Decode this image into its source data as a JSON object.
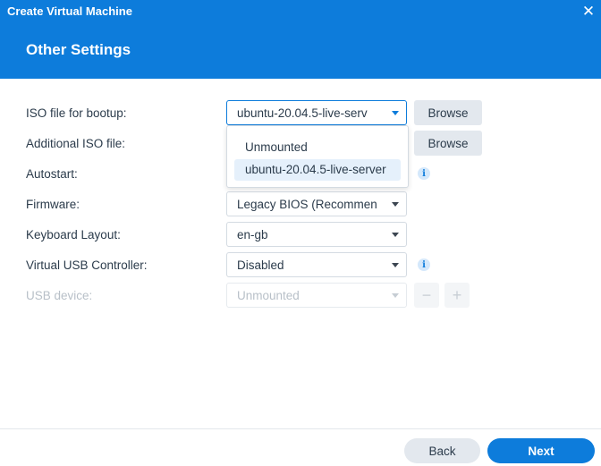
{
  "window": {
    "title": "Create Virtual Machine",
    "close_icon": "close-icon",
    "page_title": "Other Settings",
    "accent_color": "#0d7cdb"
  },
  "form": {
    "iso_bootup": {
      "label": "ISO file for bootup:",
      "value": "ubuntu-20.04.5-live-serv",
      "browse": "Browse"
    },
    "additional_iso": {
      "label": "Additional ISO file:",
      "browse": "Browse"
    },
    "autostart": {
      "label": "Autostart:",
      "info_icon": "info-icon"
    },
    "firmware": {
      "label": "Firmware:",
      "value": "Legacy BIOS (Recommen"
    },
    "keyboard": {
      "label": "Keyboard Layout:",
      "value": "en-gb"
    },
    "usb_controller": {
      "label": "Virtual USB Controller:",
      "value": "Disabled",
      "info_icon": "info-icon"
    },
    "usb_device": {
      "label": "USB device:",
      "value": "Unmounted",
      "disabled": true,
      "minus_icon": "minus-icon",
      "plus_icon": "plus-icon"
    }
  },
  "dropdown": {
    "options": [
      "Unmounted",
      "ubuntu-20.04.5-live-server"
    ],
    "selected_index": 1
  },
  "footer": {
    "back": "Back",
    "next": "Next"
  }
}
